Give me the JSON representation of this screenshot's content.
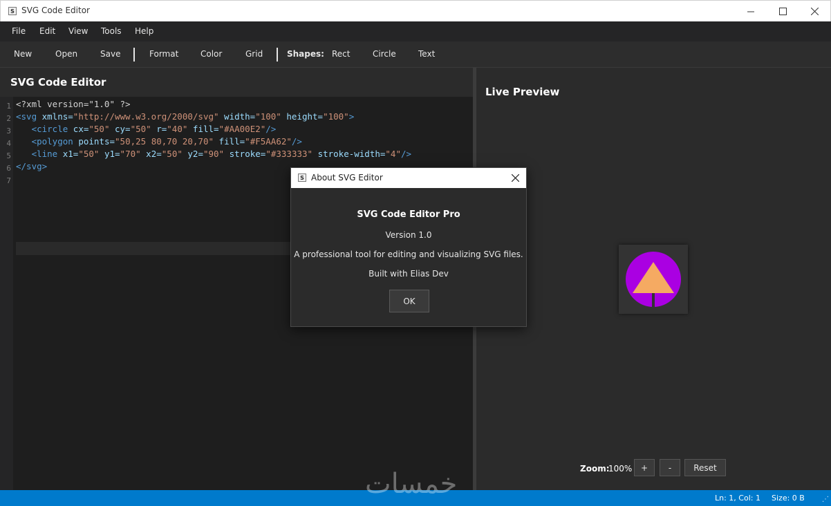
{
  "window": {
    "title": "SVG Code Editor",
    "icon": "svg-app-icon",
    "icon_glyph": "S"
  },
  "menu": [
    "File",
    "Edit",
    "View",
    "Tools",
    "Help"
  ],
  "toolbar": {
    "new": "New",
    "open": "Open",
    "save": "Save",
    "format": "Format",
    "color": "Color",
    "grid": "Grid",
    "shapes_label": "Shapes:",
    "rect": "Rect",
    "circle": "Circle",
    "text": "Text"
  },
  "editor": {
    "title": "SVG Code Editor",
    "line_numbers": [
      "1",
      "2",
      "3",
      "4",
      "5",
      "6",
      "7"
    ],
    "lines": [
      [
        {
          "t": "plain",
          "s": "<?xml version=\"1.0\" ?>"
        }
      ],
      [
        {
          "t": "tag",
          "s": "<svg"
        },
        {
          "t": "attr",
          "s": " xmlns="
        },
        {
          "t": "str",
          "s": "\"http://www.w3.org/2000/svg\""
        },
        {
          "t": "attr",
          "s": " width="
        },
        {
          "t": "str",
          "s": "\"100\""
        },
        {
          "t": "attr",
          "s": " height="
        },
        {
          "t": "str",
          "s": "\"100\""
        },
        {
          "t": "tag",
          "s": ">"
        }
      ],
      [
        {
          "t": "plain",
          "s": "   "
        },
        {
          "t": "tag",
          "s": "<circle"
        },
        {
          "t": "attr",
          "s": " cx="
        },
        {
          "t": "str",
          "s": "\"50\""
        },
        {
          "t": "attr",
          "s": " cy="
        },
        {
          "t": "str",
          "s": "\"50\""
        },
        {
          "t": "attr",
          "s": " r="
        },
        {
          "t": "str",
          "s": "\"40\""
        },
        {
          "t": "attr",
          "s": " fill="
        },
        {
          "t": "str",
          "s": "\"#AA00E2\""
        },
        {
          "t": "tag",
          "s": "/>"
        }
      ],
      [
        {
          "t": "plain",
          "s": "   "
        },
        {
          "t": "tag",
          "s": "<polygon"
        },
        {
          "t": "attr",
          "s": " points="
        },
        {
          "t": "str",
          "s": "\"50,25 80,70 20,70\""
        },
        {
          "t": "attr",
          "s": " fill="
        },
        {
          "t": "str",
          "s": "\"#F5AA62\""
        },
        {
          "t": "tag",
          "s": "/>"
        }
      ],
      [
        {
          "t": "plain",
          "s": "   "
        },
        {
          "t": "tag",
          "s": "<line"
        },
        {
          "t": "attr",
          "s": " x1="
        },
        {
          "t": "str",
          "s": "\"50\""
        },
        {
          "t": "attr",
          "s": " y1="
        },
        {
          "t": "str",
          "s": "\"70\""
        },
        {
          "t": "attr",
          "s": " x2="
        },
        {
          "t": "str",
          "s": "\"50\""
        },
        {
          "t": "attr",
          "s": " y2="
        },
        {
          "t": "str",
          "s": "\"90\""
        },
        {
          "t": "attr",
          "s": " stroke="
        },
        {
          "t": "str",
          "s": "\"#333333\""
        },
        {
          "t": "attr",
          "s": " stroke-width="
        },
        {
          "t": "str",
          "s": "\"4\""
        },
        {
          "t": "tag",
          "s": "/>"
        }
      ],
      [
        {
          "t": "tag",
          "s": "</svg>"
        }
      ],
      [
        {
          "t": "plain",
          "s": ""
        }
      ]
    ]
  },
  "preview": {
    "title": "Live Preview",
    "circle_fill": "#AA00E2",
    "triangle_fill": "#F5AA62",
    "line_stroke": "#333333",
    "zoom_label": "Zoom:",
    "zoom_value": "100%",
    "zoom_in": "+",
    "zoom_out": "-",
    "reset": "Reset"
  },
  "status": {
    "position": "Ln: 1, Col: 1",
    "size": "Size: 0 B",
    "bar_color": "#007acc"
  },
  "watermark": "خمسات",
  "dialog": {
    "title": "About SVG Editor",
    "heading": "SVG Code Editor Pro",
    "version": "Version 1.0",
    "description": "A professional tool for editing and visualizing SVG files.",
    "credit": "Built with Elias Dev",
    "ok": "OK"
  }
}
